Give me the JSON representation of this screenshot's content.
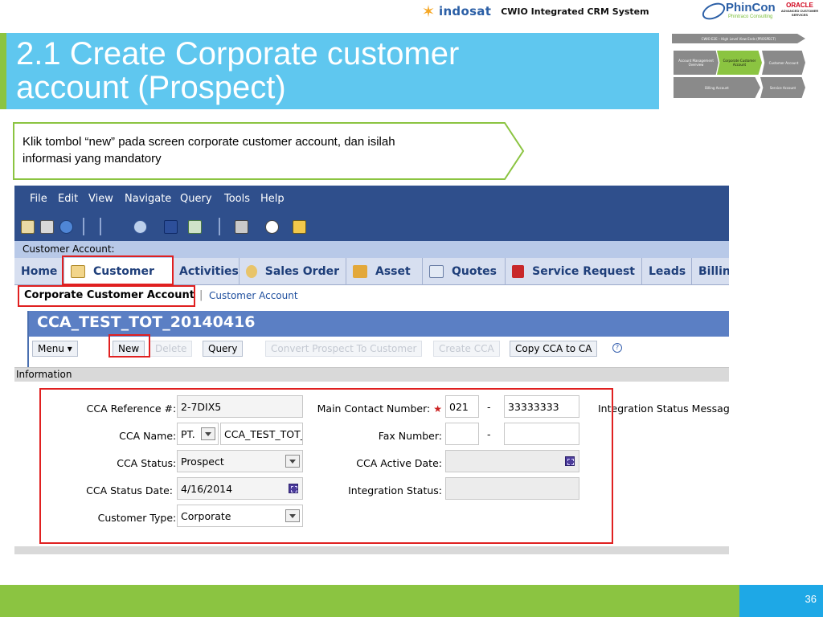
{
  "header": {
    "brand_name": "indosat",
    "system_name": "CWIO Integrated CRM System",
    "partner_logo_name": "PhinCon",
    "partner_logo_sub": "Phintraco Consulting",
    "oracle_logo_name": "ORACLE",
    "oracle_logo_sub": "ADVANCED CUSTOMER SERVICES"
  },
  "slide": {
    "title_line1": "2.1 Create Corporate customer",
    "title_line2": "account (Prospect)",
    "instruction_line1": "Klik tombol “new” pada screen corporate customer account, dan isilah",
    "instruction_line2": "informasi yang mandatory",
    "page_number": "36"
  },
  "process_flow": {
    "top": "CWIO E2E – High Level View Ends (PROSPECT)",
    "row2": [
      "Account Management Overview",
      "Corporate Customer Account",
      "Customer Account"
    ],
    "row3": [
      "Billing Account",
      "Service Account"
    ]
  },
  "app": {
    "menu": [
      "File",
      "Edit",
      "View",
      "Navigate",
      "Query",
      "Tools",
      "Help"
    ],
    "customer_account_label": "Customer Account:",
    "tabs": [
      "Home",
      "Customer",
      "Activities",
      "Sales Order",
      "Asset",
      "Quotes",
      "Service Request",
      "Leads",
      "Billin"
    ],
    "subnav_active": "Corporate Customer Account",
    "subnav_separator": "|",
    "subnav_link": "Customer Account",
    "record_title": "CCA_TEST_TOT_20140416",
    "buttons": {
      "menu": "Menu ▾",
      "new": "New",
      "delete": "Delete",
      "query": "Query",
      "convert": "Convert Prospect To Customer",
      "create_cca": "Create CCA",
      "copy": "Copy CCA to CA"
    },
    "help_icon_glyph": "?",
    "section_label": "Information",
    "form": {
      "cca_ref_label": "CCA Reference #:",
      "cca_ref_value": "2-7DIX5",
      "cca_name_label": "CCA Name:",
      "cca_name_prefix": "PT.",
      "cca_name_value": "CCA_TEST_TOT_",
      "cca_status_label": "CCA Status:",
      "cca_status_value": "Prospect",
      "cca_status_date_label": "CCA Status Date:",
      "cca_status_date_value": "4/16/2014",
      "customer_type_label": "Customer Type:",
      "customer_type_value": "Corporate",
      "main_contact_label": "Main Contact Number:",
      "main_contact_code": "021",
      "main_contact_dash": "-",
      "main_contact_number": "33333333",
      "fax_label": "Fax Number:",
      "fax_dash": "-",
      "active_date_label": "CCA Active Date:",
      "integration_status_label": "Integration Status:",
      "integration_msg_label": "Integration Status Message",
      "required_marker": "★"
    }
  },
  "colors": {
    "title_band": "#5fc7ef",
    "accent_green": "#8bc441",
    "footer_blue": "#1ea8e6",
    "app_navy": "#2f4f8c",
    "highlight_red": "#e02020"
  }
}
